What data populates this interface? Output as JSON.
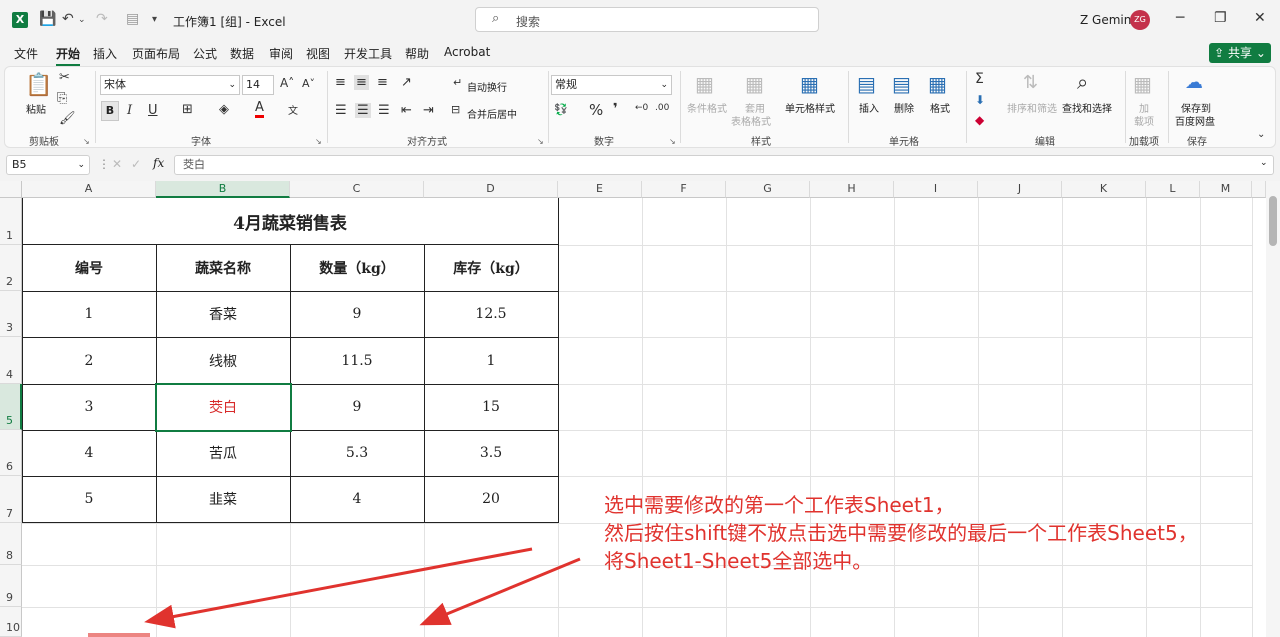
{
  "titlebar": {
    "doc_title": "工作簿1 [组] - Excel",
    "search_placeholder": "搜索",
    "user_name": "Z Gemini",
    "avatar_initials": "ZG"
  },
  "menu": {
    "items": [
      "文件",
      "开始",
      "插入",
      "页面布局",
      "公式",
      "数据",
      "审阅",
      "视图",
      "开发工具",
      "帮助",
      "Acrobat"
    ],
    "active": "开始",
    "share_label": "共享"
  },
  "ribbon": {
    "clipboard": {
      "paste": "粘贴",
      "label": "剪贴板"
    },
    "font": {
      "name": "宋体",
      "size": "14",
      "bold": "B",
      "italic": "I",
      "underline": "U",
      "label": "字体"
    },
    "alignment": {
      "wrap": "自动换行",
      "merge": "合并后居中",
      "label": "对齐方式"
    },
    "number": {
      "format": "常规",
      "label": "数字"
    },
    "styles": {
      "conditional": "条件格式",
      "table_line1": "套用",
      "table_line2": "表格格式",
      "cell_styles": "单元格样式",
      "label": "样式"
    },
    "cells": {
      "insert": "插入",
      "delete": "删除",
      "format": "格式",
      "label": "单元格"
    },
    "editing": {
      "sort": "排序和筛选",
      "find": "查找和选择",
      "label": "编辑"
    },
    "addins": {
      "line1": "加",
      "line2": "载项",
      "label": "加载项"
    },
    "save": {
      "line1": "保存到",
      "line2": "百度网盘",
      "label": "保存"
    }
  },
  "formula_bar": {
    "cell_ref": "B5",
    "content": "茭白"
  },
  "columns": [
    "A",
    "B",
    "C",
    "D",
    "E",
    "F",
    "G",
    "H",
    "I",
    "J",
    "K",
    "L",
    "M"
  ],
  "rows": [
    "1",
    "2",
    "3",
    "4",
    "5",
    "6",
    "7",
    "8",
    "9",
    "10"
  ],
  "sheet": {
    "title": "4月蔬菜销售表",
    "headers": [
      "编号",
      "蔬菜名称",
      "数量（kg）",
      "库存（kg）"
    ],
    "rows": [
      [
        "1",
        "香菜",
        "9",
        "12.5"
      ],
      [
        "2",
        "线椒",
        "11.5",
        "1"
      ],
      [
        "3",
        "茭白",
        "9",
        "15"
      ],
      [
        "4",
        "苦瓜",
        "5.3",
        "3.5"
      ],
      [
        "5",
        "韭菜",
        "4",
        "20"
      ]
    ]
  },
  "annotation": {
    "line1": "选中需要修改的第一个工作表Sheet1，",
    "line2": "然后按住shift键不放点击选中需要修改的最后一个工作表Sheet5，",
    "line3": "将Sheet1-Sheet5全部选中。"
  },
  "colors": {
    "accent": "#107c41",
    "annotation": "#e0332e"
  }
}
